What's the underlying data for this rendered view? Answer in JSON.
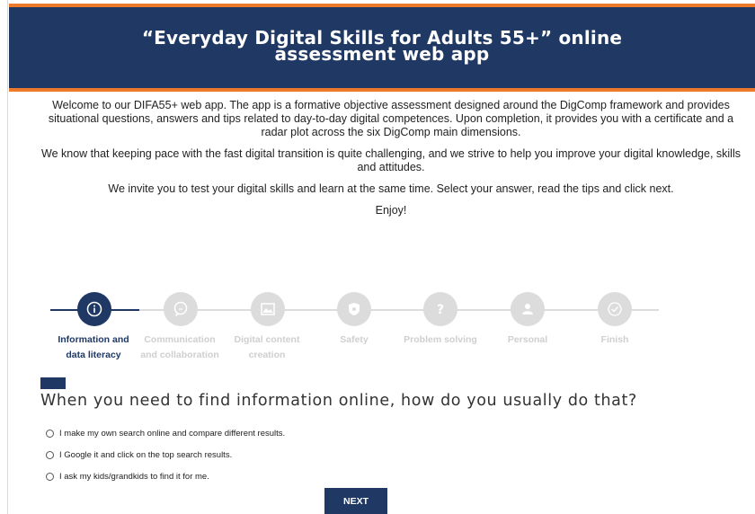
{
  "header": {
    "title_line1": "“Everyday Digital Skills for Adults 55+” online",
    "title_line2": "assessment web app"
  },
  "intro": {
    "paragraphs": [
      "Welcome to our DIFA55+ web app. The app is a formative objective assessment designed around the DigComp framework and provides situational questions, answers and tips related to day-to-day digital competences. Upon completion, it provides you with a certificate and a radar plot across the six DigComp main dimensions.",
      "We know that keeping pace with the fast digital transition is quite challenging, and we strive to help you improve your digital knowledge, skills and attitudes.",
      "We invite you to test your digital skills and learn at the same time. Select your answer, read the tips and click next.",
      "Enjoy!"
    ]
  },
  "steps": [
    {
      "label_line1": "Information and",
      "label_line2": "data literacy",
      "icon": "info-icon",
      "active": true
    },
    {
      "label_line1": "Communication",
      "label_line2": "and collaboration",
      "icon": "chat-icon",
      "active": false
    },
    {
      "label_line1": "Digital content",
      "label_line2": "creation",
      "icon": "image-icon",
      "active": false
    },
    {
      "label_line1": "Safety",
      "label_line2": "",
      "icon": "shield-icon",
      "active": false
    },
    {
      "label_line1": "Problem solving",
      "label_line2": "",
      "icon": "question-icon",
      "active": false
    },
    {
      "label_line1": "Personal",
      "label_line2": "",
      "icon": "person-icon",
      "active": false
    },
    {
      "label_line1": "Finish",
      "label_line2": "",
      "icon": "check-icon",
      "active": false
    }
  ],
  "question": {
    "text": "When you need to find information online, how do you usually do that?",
    "options": [
      "I make my own search online and compare different results.",
      "I Google it and click on the top search results.",
      "I ask my kids/grandkids to find it for me."
    ]
  },
  "next_label": "NEXT",
  "colors": {
    "navy": "#1f3864",
    "orange": "#ec7a2a",
    "inactive": "#dcdcdc"
  }
}
